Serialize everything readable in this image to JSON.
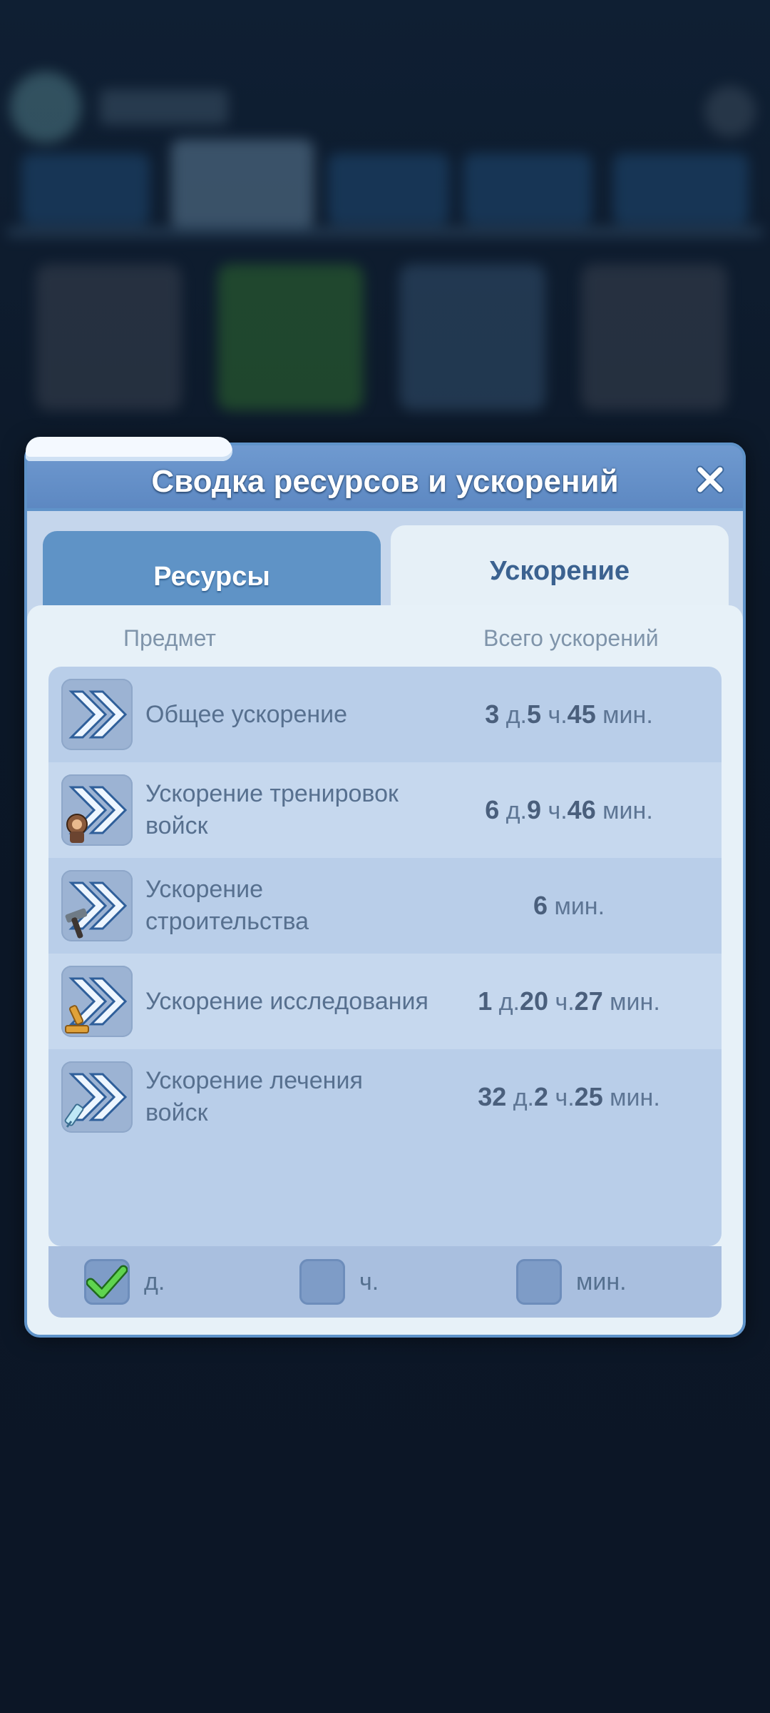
{
  "dialog": {
    "title": "Сводка ресурсов и ускорений",
    "tabs": {
      "resources": "Ресурсы",
      "speedups": "Ускорение"
    },
    "columns": {
      "item": "Предмет",
      "total": "Всего ускорений"
    },
    "rows": [
      {
        "name": "Общее ускорение",
        "icon": "general-speedup-icon",
        "value": {
          "d": "3",
          "d_unit": "д.",
          "h": "5",
          "h_unit": "ч.",
          "m": "45",
          "m_unit": "мин."
        }
      },
      {
        "name": "Ускорение тренировок войск",
        "icon": "training-speedup-icon",
        "value": {
          "d": "6",
          "d_unit": "д.",
          "h": "9",
          "h_unit": "ч.",
          "m": "46",
          "m_unit": "мин."
        }
      },
      {
        "name": "Ускорение строительства",
        "icon": "construction-speedup-icon",
        "value": {
          "m": "6",
          "m_unit": "мин."
        }
      },
      {
        "name": "Ускорение исследования",
        "icon": "research-speedup-icon",
        "value": {
          "d": "1",
          "d_unit": "д.",
          "h": "20",
          "h_unit": "ч.",
          "m": "27",
          "m_unit": "мин."
        }
      },
      {
        "name": "Ускорение лечения войск",
        "icon": "healing-speedup-icon",
        "value": {
          "d": "32",
          "d_unit": "д.",
          "h": "2",
          "h_unit": "ч.",
          "m": "25",
          "m_unit": "мин."
        }
      }
    ],
    "filters": [
      {
        "label": "д.",
        "checked": true
      },
      {
        "label": "ч.",
        "checked": false
      },
      {
        "label": "мин.",
        "checked": false
      }
    ]
  },
  "colors": {
    "header": "#5d88c2",
    "active_tab": "#e6f0f7",
    "inactive_tab": "#5f93c6",
    "check_green": "#3fb53a"
  }
}
